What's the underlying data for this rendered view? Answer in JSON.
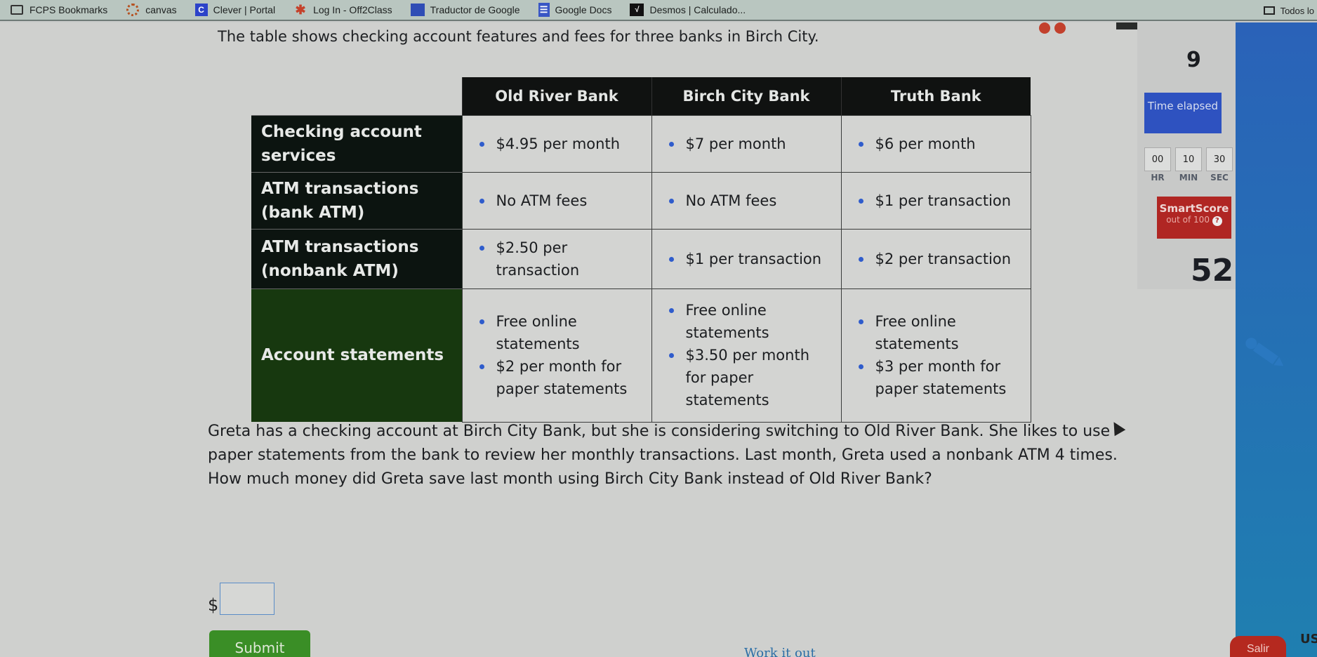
{
  "bookmarks": [
    {
      "label": "FCPS Bookmarks",
      "icon": "folder-icon"
    },
    {
      "label": "canvas",
      "icon": "canvas-icon"
    },
    {
      "label": "Clever | Portal",
      "icon": "clever-icon",
      "glyph": "C"
    },
    {
      "label": "Log In - Off2Class",
      "icon": "off2class-icon",
      "glyph": "✱"
    },
    {
      "label": "Traductor de Google",
      "icon": "google-translate-icon"
    },
    {
      "label": "Google Docs",
      "icon": "google-docs-icon",
      "glyph": "☰"
    },
    {
      "label": "Desmos | Calculado...",
      "icon": "desmos-icon",
      "glyph": "√"
    }
  ],
  "bookmarks_overflow": "Todos lo",
  "problem": {
    "intro": "The table shows checking account features and fees for three banks in Birch City.",
    "table": {
      "columns": [
        "Old River Bank",
        "Birch City Bank",
        "Truth Bank"
      ],
      "rows": [
        {
          "header": "Checking account services",
          "cells": [
            [
              "$4.95 per month"
            ],
            [
              "$7 per month"
            ],
            [
              "$6 per month"
            ]
          ]
        },
        {
          "header": "ATM transactions (bank ATM)",
          "cells": [
            [
              "No ATM fees"
            ],
            [
              "No ATM fees"
            ],
            [
              "$1 per transaction"
            ]
          ]
        },
        {
          "header": "ATM transactions (nonbank ATM)",
          "cells": [
            [
              "$2.50 per transaction"
            ],
            [
              "$1 per transaction"
            ],
            [
              "$2 per transaction"
            ]
          ]
        },
        {
          "header": "Account statements",
          "cells": [
            [
              "Free online statements",
              "$2 per month for paper statements"
            ],
            [
              "Free online statements",
              "$3.50 per month for paper statements"
            ],
            [
              "Free online statements",
              "$3 per month for paper statements"
            ]
          ]
        }
      ]
    },
    "question": "Greta has a checking account at Birch City Bank, but she is considering switching to Old River Bank. She likes to use paper statements from the bank to review her monthly transactions. Last month, Greta used a nonbank ATM 4 times. How much money did Greta save last month using Birch City Bank instead of Old River Bank?",
    "answer_prefix": "$",
    "answer_value": "",
    "submit_label": "Submit",
    "work_it_out_label": "Work it out"
  },
  "sidebar": {
    "question_number": "9",
    "time_label": "Time elapsed",
    "timer": {
      "hr": "00",
      "min": "10",
      "sec": "30"
    },
    "timer_labels": {
      "hr": "HR",
      "min": "MIN",
      "sec": "SEC"
    },
    "smartscore_title": "SmartScore",
    "smartscore_sub": "out of 100",
    "smartscore": "52"
  },
  "footer": {
    "exit_label": "Salir",
    "corner_text": "US"
  },
  "colors": {
    "table_header": "#101211",
    "row_header_green": "#17380f",
    "bullet": "#2f5ccc",
    "time_box": "#2e52c0",
    "smartscore_box": "#b02623",
    "submit": "#3a8e26"
  }
}
